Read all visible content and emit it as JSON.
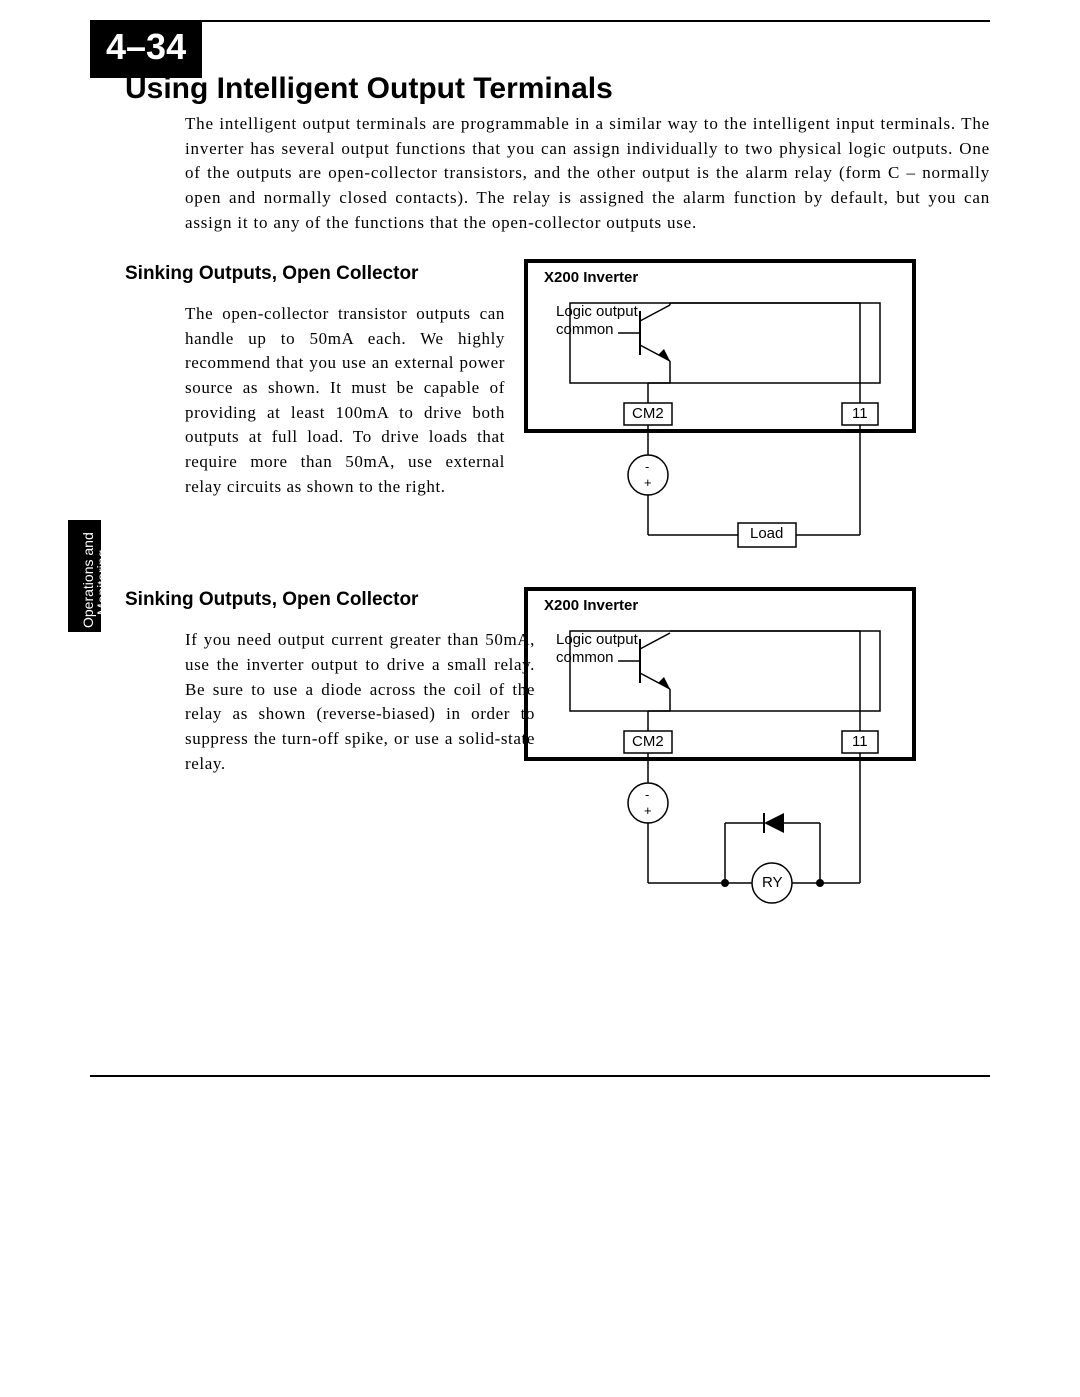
{
  "page_number": "4–34",
  "title": "Using Intelligent Output Terminals",
  "intro": "The intelligent output terminals are programmable in a similar way to the intelligent input terminals. The inverter has several output functions that you can assign individually to two physical logic outputs. One of the outputs are open-collector transistors, and the other output is the alarm relay (form C – normally open and normally closed contacts). The relay is assigned the alarm function by default, but you can assign it to any of the functions that the open-collector outputs use.",
  "side_tab_line1": "Operations and",
  "side_tab_line2": "Monitoring",
  "sections": [
    {
      "heading": "Sinking Outputs, Open Collector",
      "body": "The open-collector transistor outputs can handle up to 50mA each. We highly recommend that you use an external power source as shown. It must be capable of providing at least 100mA to drive both outputs at full load. To drive loads that require more than 50mA, use external relay circuits as shown to the right."
    },
    {
      "heading": "Sinking Outputs, Open Collector",
      "body": "If you need output current greater than 50mA, use the inverter output to drive a small relay. Be sure to use a diode across the coil of the relay as shown (reverse-biased) in order to suppress the turn-off spike, or use a solid-state relay."
    }
  ],
  "diagram": {
    "box_title": "X200 Inverter",
    "logic_output": "Logic output",
    "common": "common",
    "cm2": "CM2",
    "terminal11": "11",
    "load": "Load",
    "ry": "RY",
    "minus": "-",
    "plus": "+"
  }
}
